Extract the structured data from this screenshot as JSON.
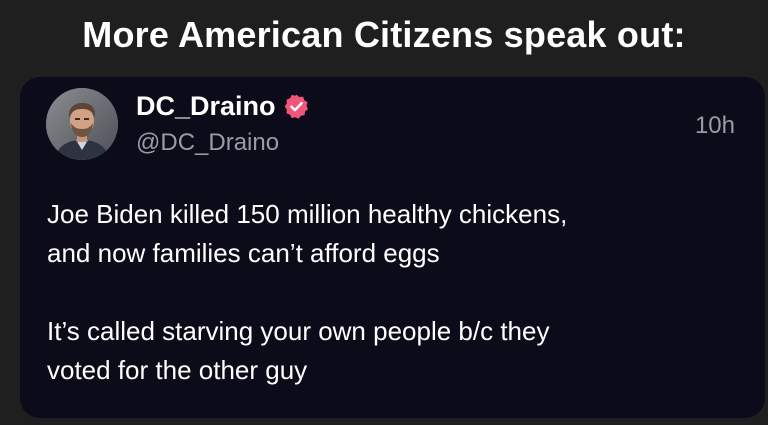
{
  "headline": "More American Citizens speak out:",
  "post": {
    "display_name": "DC_Draino",
    "handle": "@DC_Draino",
    "timestamp": "10h",
    "verified": true,
    "verified_color": "#f0557a",
    "avatar_icon": "profile-photo",
    "text": {
      "line1": "Joe Biden killed 150 million healthy chickens,",
      "line2": "and now families can’t afford eggs",
      "line3": "It’s called starving your own people b/c they",
      "line4": "voted for the other guy"
    }
  },
  "colors": {
    "page_background": "#1f1f1f",
    "card_background": "#0c0b1a",
    "primary_text": "#ffffff",
    "secondary_text": "#9b9ba3"
  }
}
